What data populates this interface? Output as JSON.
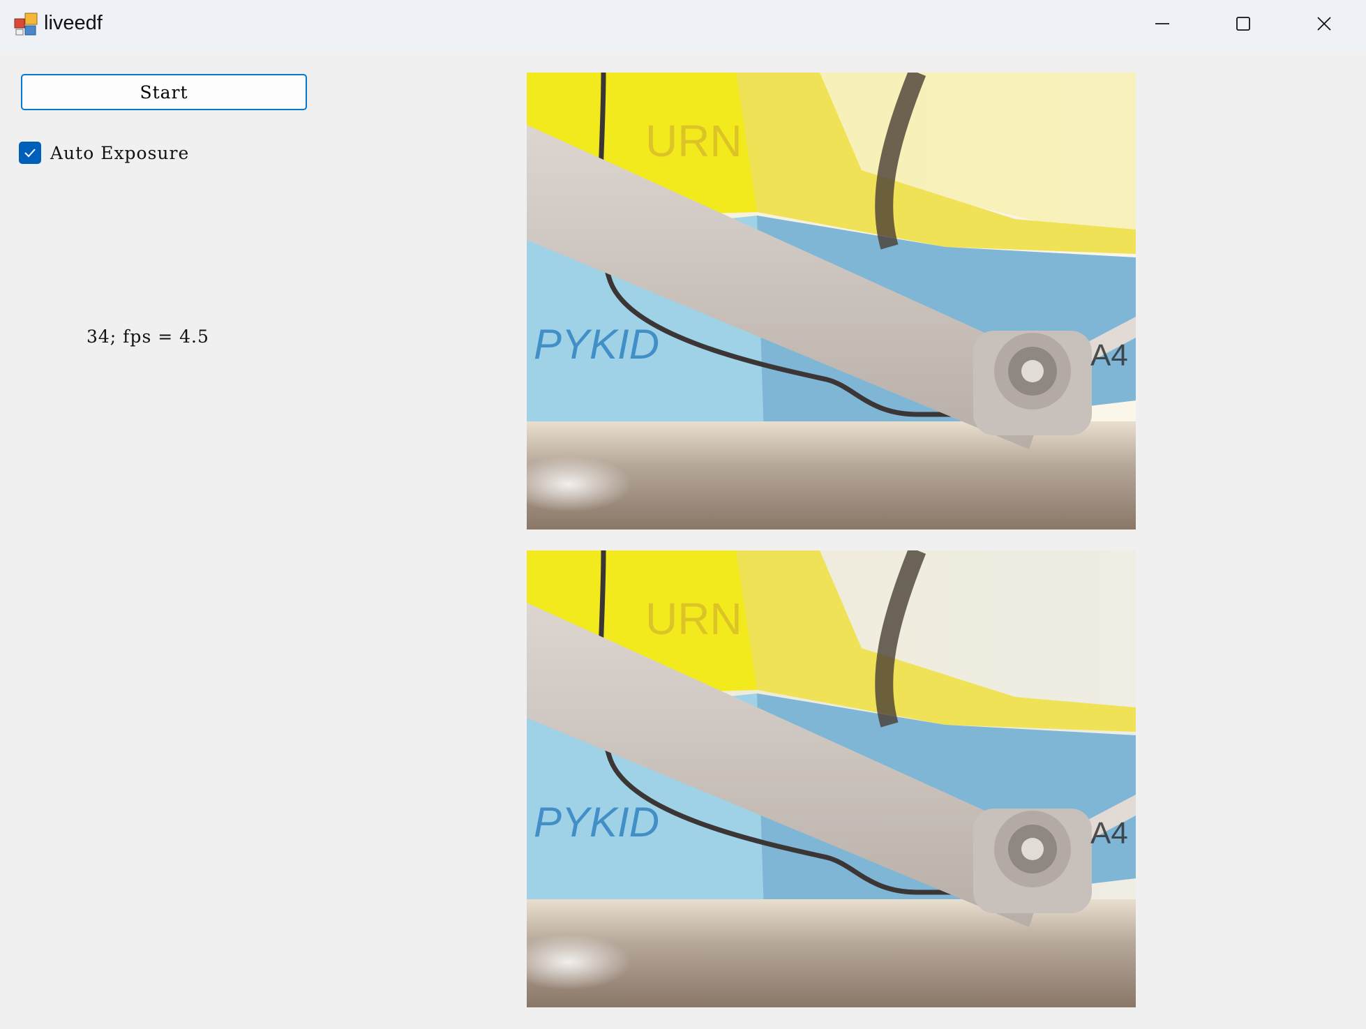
{
  "window": {
    "title": "liveedf",
    "controls": {
      "minimize_icon": "minimize-icon",
      "maximize_icon": "maximize-icon",
      "close_icon": "close-icon"
    }
  },
  "controls": {
    "start_label": "Start",
    "auto_exposure_label": "Auto Exposure",
    "auto_exposure_checked": true,
    "status_text": "34; fps = 4.5"
  },
  "frames": [
    {
      "name": "camera-frame-top",
      "signs": {
        "brand_text": "PYKID",
        "box_text": "A4",
        "yellow_text": "URN"
      }
    },
    {
      "name": "camera-frame-bottom",
      "signs": {
        "brand_text": "PYKID",
        "box_text": "A4",
        "yellow_text": "URN"
      }
    }
  ],
  "colors": {
    "accent": "#005fb8",
    "button_border": "#0078d4",
    "background": "#f0f0f0",
    "titlebar": "#eef2f7"
  }
}
